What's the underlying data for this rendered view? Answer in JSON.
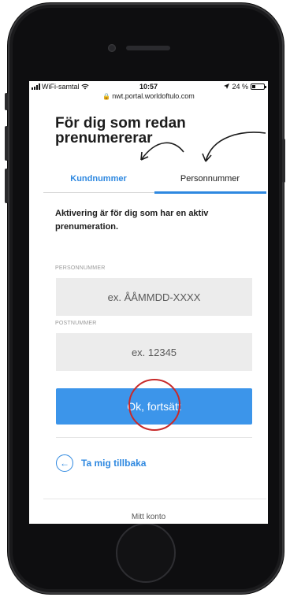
{
  "status_bar": {
    "carrier": "WiFi-samtal",
    "time": "10:57",
    "battery": "24 %",
    "location_icon": "location-arrow-icon",
    "wifi_icon": "wifi-icon"
  },
  "browser": {
    "url": "nwt.portal.worldoftulo.com",
    "lock_icon": "lock-icon"
  },
  "page": {
    "title": "För dig som redan prenumererar",
    "tabs": [
      {
        "label": "Kundnummer",
        "active": false
      },
      {
        "label": "Personnummer",
        "active": true
      }
    ],
    "info_text": "Aktivering är för dig som har en aktiv prenumeration.",
    "fields": {
      "personnummer": {
        "label": "PERSONNUMMER",
        "placeholder": "ex. ÅÅMMDD-XXXX",
        "value": ""
      },
      "postnummer": {
        "label": "POSTNUMMER",
        "placeholder": "ex. 12345",
        "value": ""
      }
    },
    "submit_label": "Ok, fortsätt",
    "back_label": "Ta mig tillbaka",
    "footer_link": "Mitt konto"
  },
  "colors": {
    "accent": "#2e88e0",
    "button": "#3c95ea",
    "highlight": "#c82a2a"
  }
}
